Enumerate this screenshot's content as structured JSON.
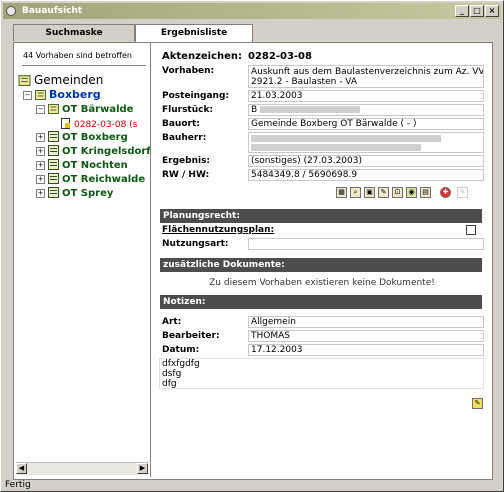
{
  "window": {
    "title": "Bauaufsicht",
    "minimize": "_",
    "maximize": "□",
    "close": "×"
  },
  "tabs": [
    {
      "label": "Suchmaske",
      "active": false
    },
    {
      "label": "Ergebnisliste",
      "active": true
    }
  ],
  "left": {
    "count_text": "44 Vorhaben sind betroffen",
    "tree": [
      {
        "label": "Gemeinden",
        "level": 0
      },
      {
        "label": "Boxberg",
        "level": 1
      },
      {
        "label": "OT Bärwalde",
        "level": 2
      },
      {
        "label": "0282-03-08 (s",
        "level": 3,
        "selected": true
      },
      {
        "label": "OT Boxberg",
        "level": 2
      },
      {
        "label": "OT Kringelsdorf",
        "level": 2
      },
      {
        "label": "OT Nochten",
        "level": 2
      },
      {
        "label": "OT Reichwalde",
        "level": 2
      },
      {
        "label": "OT Sprey",
        "level": 2
      }
    ]
  },
  "details": {
    "aktenzeichen_label": "Aktenzeichen:",
    "aktenzeichen": "0282-03-08",
    "vorhaben_label": "Vorhaben:",
    "vorhaben_line1": "Auskunft aus dem Baulastenverzeichnis zum Az. VV",
    "vorhaben_line2": "2921.2 - Baulasten - VA",
    "posteingang_label": "Posteingang:",
    "posteingang": "21.03.2003",
    "flurstueck_label": "Flurstück:",
    "flurstueck": "B",
    "bauort_label": "Bauort:",
    "bauort": "Gemeinde Boxberg OT Bärwalde ( - )",
    "bauherr_label": "Bauherr:",
    "ergebnis_label": "Ergebnis:",
    "ergebnis": "(sonstiges) (27.03.2003)",
    "rw_hw_label": "RW / HW:",
    "rw_hw": "5484349.8 / 5690698.9"
  },
  "sections": {
    "planungsrecht": "Planungsrecht:",
    "flaechen_label": "Flächennutzungsplan:",
    "nutzungsart_label": "Nutzungsart:",
    "dokumente": "zusätzliche Dokumente:",
    "dokumente_msg": "Zu diesem Vorhaben existieren keine Dokumente!",
    "notizen": "Notizen:"
  },
  "notizen": {
    "art_label": "Art:",
    "art": "Allgemein",
    "bearbeiter_label": "Bearbeiter:",
    "bearbeiter": "THOMAS",
    "datum_label": "Datum:",
    "datum": "17.12.2003",
    "text_lines": [
      "dfxfgdfg",
      "dsfg",
      "dfg"
    ]
  },
  "status": "Fertig",
  "toolbar_icons": [
    "map-icon",
    "zoom-map-icon",
    "print-icon",
    "edit-icon",
    "search-doc-icon",
    "camera-icon",
    "document-icon",
    "red-cross-icon",
    "pin-icon"
  ],
  "colors": {
    "tree_green": "#0b5a12",
    "selected_red": "#cc0000",
    "section_bg": "#4d4d4d"
  }
}
